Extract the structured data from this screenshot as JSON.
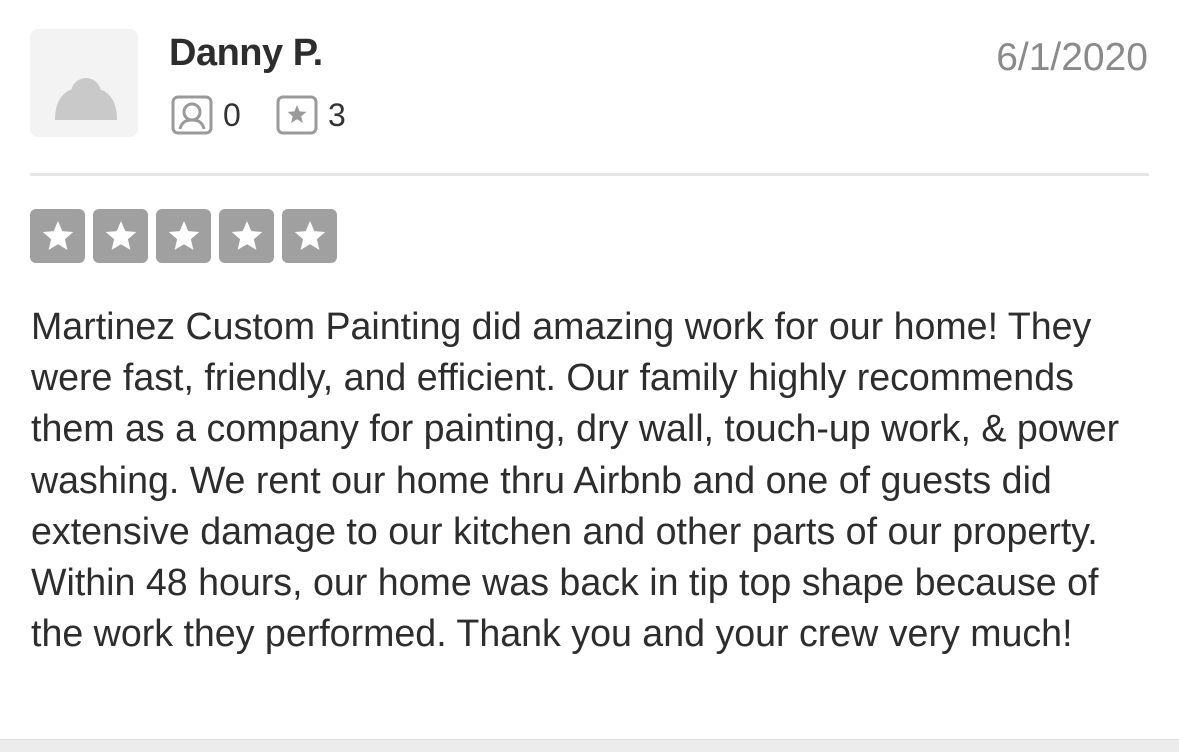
{
  "reviewer": {
    "name": "Danny P.",
    "avatar_icon": "default-user-avatar-icon",
    "friends_icon": "friends-icon",
    "friends_count": "0",
    "reviews_icon": "review-star-icon",
    "reviews_count": "3"
  },
  "review": {
    "date": "6/1/2020",
    "rating": 5,
    "rating_max": 5,
    "star_color": "#a0a0a0",
    "text": "Martinez Custom Painting did amazing work for our home! They were fast, friendly, and efficient. Our family highly recommends them as a company for painting, dry wall, touch-up work, & power washing. We rent our home thru Airbnb and one of guests did extensive damage to our kitchen and other parts of our property. Within 48 hours, our home was back in tip top shape because of the work they performed. Thank you and your crew very much!"
  }
}
